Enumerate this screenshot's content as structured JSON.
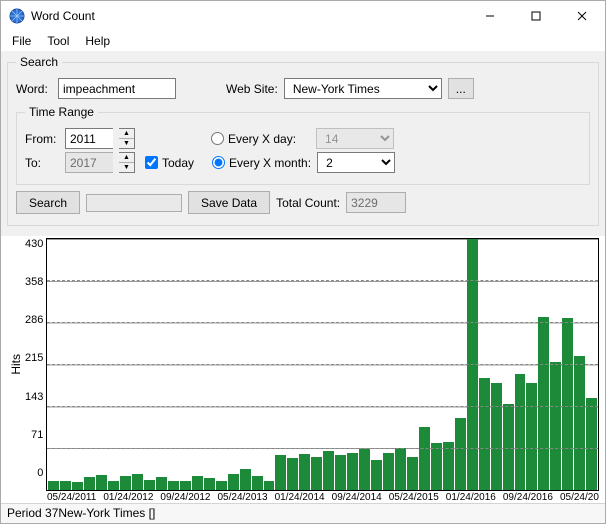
{
  "window": {
    "title": "Word Count"
  },
  "menu": {
    "file": "File",
    "tool": "Tool",
    "help": "Help"
  },
  "search": {
    "legend": "Search",
    "word_label": "Word:",
    "word_value": "impeachment",
    "website_label": "Web Site:",
    "website_value": "New-York Times",
    "browse_label": "..."
  },
  "timerange": {
    "legend": "Time Range",
    "from_label": "From:",
    "from_value": "2011",
    "to_label": "To:",
    "to_value": "2017",
    "today_label": "Today",
    "today_checked": true,
    "every_day_label": "Every X day:",
    "every_day_value": "14",
    "every_month_label": "Every X month:",
    "every_month_value": "2",
    "interval_mode": "month"
  },
  "actions": {
    "search_label": "Search",
    "savedata_label": "Save Data",
    "totalcount_label": "Total Count:",
    "totalcount_value": "3229"
  },
  "chart_data": {
    "type": "bar",
    "ylabel": "Hits",
    "ylim": [
      0,
      430
    ],
    "yticks": [
      0,
      71,
      143,
      215,
      286,
      358,
      430
    ],
    "xticks": [
      "05/24/2011",
      "01/24/2012",
      "09/24/2012",
      "05/24/2013",
      "01/24/2014",
      "09/24/2014",
      "05/24/2015",
      "01/24/2016",
      "09/24/2016",
      "05/24/20"
    ],
    "values": [
      16,
      15,
      14,
      22,
      26,
      16,
      24,
      27,
      18,
      22,
      16,
      15,
      24,
      20,
      15,
      28,
      36,
      24,
      16,
      60,
      54,
      62,
      56,
      66,
      60,
      64,
      70,
      52,
      64,
      72,
      56,
      108,
      80,
      82,
      124,
      430,
      192,
      184,
      148,
      198,
      184,
      296,
      220,
      294,
      230,
      158
    ]
  },
  "status": {
    "text": "Period 37New-York Times []"
  }
}
